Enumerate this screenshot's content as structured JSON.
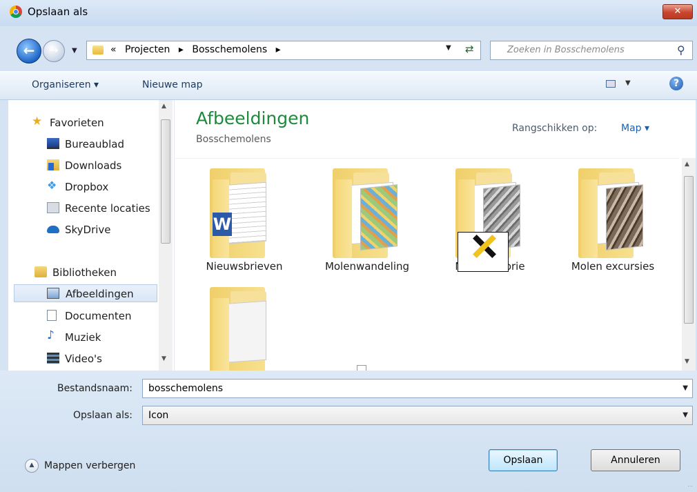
{
  "window": {
    "title": "Opslaan als",
    "close_label": "✕"
  },
  "address": {
    "crumbs": [
      "«",
      "Projecten",
      "▸",
      "Bosschemolens",
      "▸"
    ]
  },
  "search": {
    "placeholder": "Zoeken in Bosschemolens"
  },
  "toolbar": {
    "organize_label": "Organiseren ▾",
    "new_folder_label": "Nieuwe map"
  },
  "sidebar": {
    "items": [
      {
        "label": "Favorieten",
        "icon": "star-icon",
        "group": true
      },
      {
        "label": "Bureaublad",
        "icon": "desktop-icon"
      },
      {
        "label": "Downloads",
        "icon": "downloads-icon"
      },
      {
        "label": "Dropbox",
        "icon": "dropbox-icon"
      },
      {
        "label": "Recente locaties",
        "icon": "recent-locations-icon"
      },
      {
        "label": "SkyDrive",
        "icon": "skydrive-icon"
      },
      {
        "label": "Bibliotheken",
        "icon": "libraries-icon",
        "group": true
      },
      {
        "label": "Afbeeldingen",
        "icon": "pictures-icon",
        "selected": true
      },
      {
        "label": "Documenten",
        "icon": "documents-icon"
      },
      {
        "label": "Muziek",
        "icon": "music-icon"
      },
      {
        "label": "Video's",
        "icon": "videos-icon"
      }
    ]
  },
  "library": {
    "title": "Afbeeldingen",
    "subtitle": "Bosschemolens",
    "arrange_label": "Rangschikken op:",
    "arrange_value": "Map ▾"
  },
  "folders": [
    {
      "label": "Nieuwsbrieven",
      "preview": "word-document"
    },
    {
      "label": "Molenwandeling",
      "preview": "map"
    },
    {
      "label": "Molenhistorie",
      "preview": "photos"
    },
    {
      "label": "Molen excursies",
      "preview": "sepia-photos"
    },
    {
      "label": "",
      "preview": "paper"
    }
  ],
  "form": {
    "filename_label": "Bestandsnaam:",
    "filename_value": "bosschemolens",
    "savetype_label": "Opslaan als:",
    "savetype_value": "Icon"
  },
  "footer": {
    "toggle_label": "Mappen verbergen",
    "save_label": "Opslaan",
    "cancel_label": "Annuleren"
  },
  "colors": {
    "library_title": "#1e8a3c",
    "link": "#1a5fb4",
    "close": "#c9452f"
  }
}
